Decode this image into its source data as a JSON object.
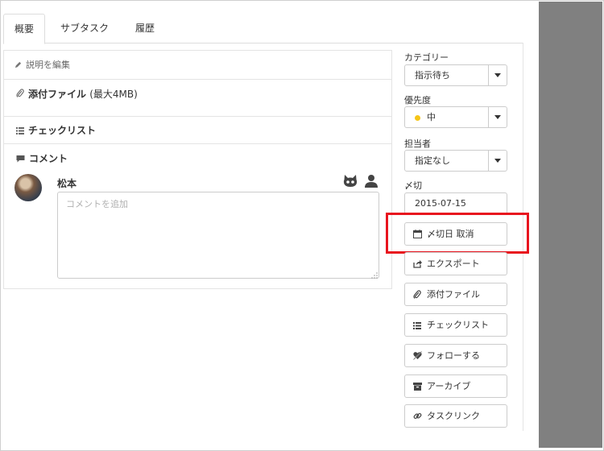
{
  "tabs": [
    {
      "label": "概要",
      "active": true
    },
    {
      "label": "サブタスク",
      "active": false
    },
    {
      "label": "履歴",
      "active": false
    }
  ],
  "sections": {
    "description_edit": "説明を編集",
    "attachment_title": "添付ファイル",
    "attachment_limit": "(最大4MB)",
    "checklist_title": "チェックリスト",
    "comment_title": "コメント"
  },
  "comment": {
    "author": "松本",
    "placeholder": "コメントを追加"
  },
  "fields": {
    "category": {
      "label": "カテゴリー",
      "value": "指示待ち"
    },
    "priority": {
      "label": "優先度",
      "value": "中",
      "dot_color": "#f5c518"
    },
    "assignee": {
      "label": "担当者",
      "value": "指定なし"
    },
    "due": {
      "label": "〆切",
      "value": "2015-07-15"
    }
  },
  "actions": [
    {
      "label": "〆切日 取消",
      "icon": "calendar-icon"
    },
    {
      "label": "エクスポート",
      "icon": "share-icon"
    },
    {
      "label": "添付ファイル",
      "icon": "paperclip-icon"
    },
    {
      "label": "チェックリスト",
      "icon": "list-icon"
    },
    {
      "label": "フォローする",
      "icon": "follow-icon"
    },
    {
      "label": "アーカイブ",
      "icon": "archive-icon"
    },
    {
      "label": "タスクリンク",
      "icon": "link-icon"
    }
  ],
  "colors": {
    "highlight": "#e8141e",
    "side_panel": "#808080"
  }
}
